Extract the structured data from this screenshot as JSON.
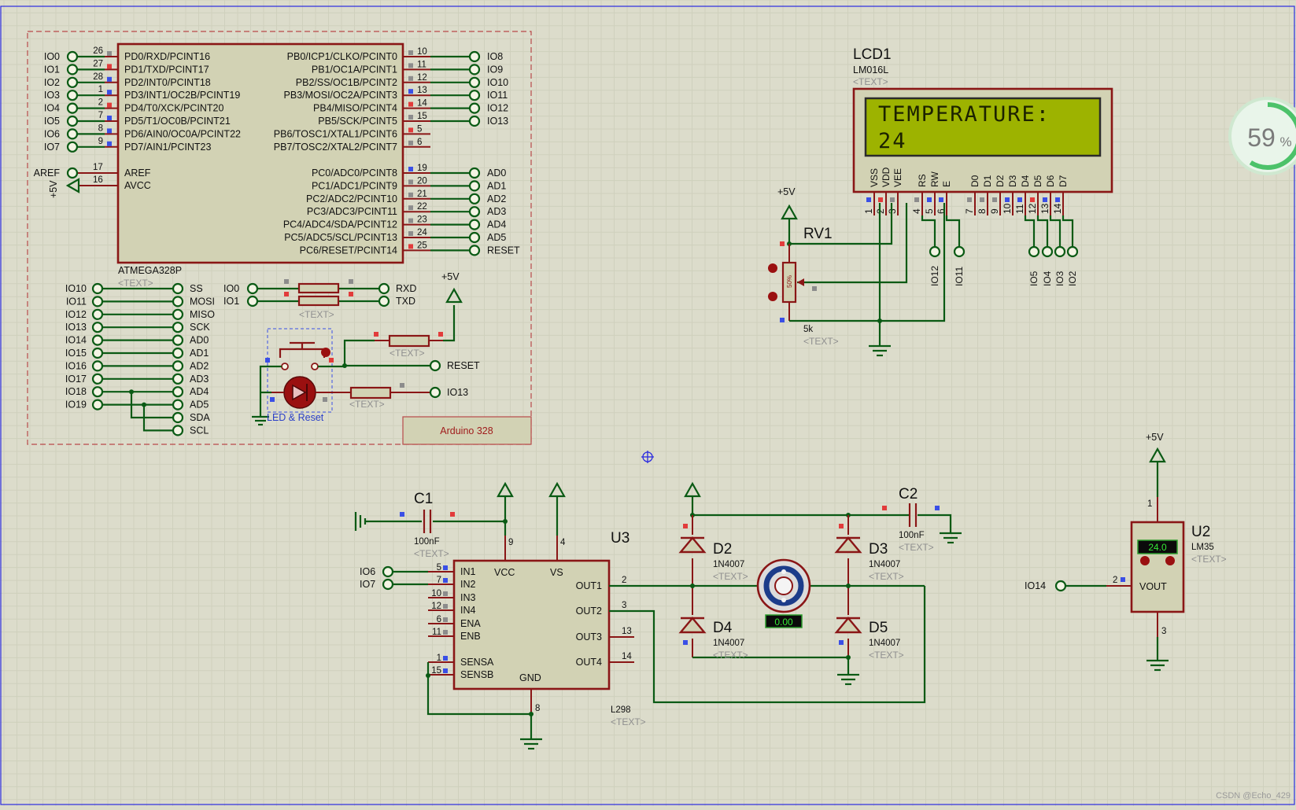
{
  "badge": {
    "value": "59",
    "unit": "%"
  },
  "watermark": "CSDN @Echo_429",
  "arduino": {
    "frame_label": "Arduino 328",
    "chip": "ATMEGA328P",
    "text": "<TEXT>",
    "left_pins": [
      {
        "num": "26",
        "name": "PD0/RXD/PCINT16",
        "net": "IO0"
      },
      {
        "num": "27",
        "name": "PD1/TXD/PCINT17",
        "net": "IO1"
      },
      {
        "num": "28",
        "name": "PD2/INT0/PCINT18",
        "net": "IO2"
      },
      {
        "num": "1",
        "name": "PD3/INT1/OC2B/PCINT19",
        "net": "IO3"
      },
      {
        "num": "2",
        "name": "PD4/T0/XCK/PCINT20",
        "net": "IO4"
      },
      {
        "num": "7",
        "name": "PD5/T1/OC0B/PCINT21",
        "net": "IO5"
      },
      {
        "num": "8",
        "name": "PD6/AIN0/OC0A/PCINT22",
        "net": "IO6"
      },
      {
        "num": "9",
        "name": "PD7/AIN1/PCINT23",
        "net": "IO7"
      }
    ],
    "aref": {
      "num": "17",
      "name": "AREF",
      "net": "AREF"
    },
    "avcc": {
      "num": "16",
      "name": "AVCC",
      "net": "+5V"
    },
    "right_pins_b": [
      {
        "num": "10",
        "name": "PB0/ICP1/CLKO/PCINT0",
        "net": "IO8"
      },
      {
        "num": "11",
        "name": "PB1/OC1A/PCINT1",
        "net": "IO9"
      },
      {
        "num": "12",
        "name": "PB2/SS/OC1B/PCINT2",
        "net": "IO10"
      },
      {
        "num": "13",
        "name": "PB3/MOSI/OC2A/PCINT3",
        "net": "IO11"
      },
      {
        "num": "14",
        "name": "PB4/MISO/PCINT4",
        "net": "IO12"
      },
      {
        "num": "15",
        "name": "PB5/SCK/PCINT5",
        "net": "IO13"
      },
      {
        "num": "5",
        "name": "PB6/TOSC1/XTAL1/PCINT6",
        "net": ""
      },
      {
        "num": "6",
        "name": "PB7/TOSC2/XTAL2/PCINT7",
        "net": ""
      }
    ],
    "right_pins_c": [
      {
        "num": "19",
        "name": "PC0/ADC0/PCINT8",
        "net": "AD0"
      },
      {
        "num": "20",
        "name": "PC1/ADC1/PCINT9",
        "net": "AD1"
      },
      {
        "num": "21",
        "name": "PC2/ADC2/PCINT10",
        "net": "AD2"
      },
      {
        "num": "22",
        "name": "PC3/ADC3/PCINT11",
        "net": "AD3"
      },
      {
        "num": "23",
        "name": "PC4/ADC4/SDA/PCINT12",
        "net": "AD4"
      },
      {
        "num": "24",
        "name": "PC5/ADC5/SCL/PCINT13",
        "net": "AD5"
      },
      {
        "num": "25",
        "name": "PC6/RESET/PCINT14",
        "net": "RESET"
      }
    ],
    "header": [
      {
        "left": "IO10",
        "right": "SS"
      },
      {
        "left": "IO11",
        "right": "MOSI"
      },
      {
        "left": "IO12",
        "right": "MISO"
      },
      {
        "left": "IO13",
        "right": "SCK"
      },
      {
        "left": "IO14",
        "right": "AD0"
      },
      {
        "left": "IO15",
        "right": "AD1"
      },
      {
        "left": "IO16",
        "right": "AD2"
      },
      {
        "left": "IO17",
        "right": "AD3"
      },
      {
        "left": "IO18",
        "right": "AD4"
      },
      {
        "left": "IO19",
        "right": "AD5"
      },
      {
        "left": "",
        "right": "SDA"
      },
      {
        "left": "",
        "right": "SCL"
      }
    ],
    "uart": {
      "a": "IO0",
      "b": "IO1",
      "rx": "RXD",
      "tx": "TXD"
    },
    "vcc": "+5V",
    "reset_label": "RESET",
    "io13_label": "IO13",
    "led_reset_label": "LED & Reset"
  },
  "lcd": {
    "ref": "LCD1",
    "model": "LM016L",
    "text": "<TEXT>",
    "line1": "TEMPERATURE:",
    "line2": "24",
    "pins": [
      {
        "num": "1",
        "name": "VSS"
      },
      {
        "num": "2",
        "name": "VDD"
      },
      {
        "num": "3",
        "name": "VEE"
      },
      {
        "num": "4",
        "name": "RS"
      },
      {
        "num": "5",
        "name": "RW"
      },
      {
        "num": "6",
        "name": "E"
      },
      {
        "num": "7",
        "name": "D0"
      },
      {
        "num": "8",
        "name": "D1"
      },
      {
        "num": "9",
        "name": "D2"
      },
      {
        "num": "10",
        "name": "D3"
      },
      {
        "num": "11",
        "name": "D4"
      },
      {
        "num": "12",
        "name": "D5"
      },
      {
        "num": "13",
        "name": "D6"
      },
      {
        "num": "14",
        "name": "D7"
      }
    ],
    "nets": {
      "rs": "IO12",
      "e": "IO11",
      "d4": "IO5",
      "d5": "IO4",
      "d6": "IO3",
      "d7": "IO2"
    }
  },
  "rv1": {
    "ref": "RV1",
    "value": "5k",
    "text": "<TEXT>",
    "vcc": "+5V",
    "pct": "50%"
  },
  "c1": {
    "ref": "C1",
    "value": "100nF",
    "text": "<TEXT>"
  },
  "c2": {
    "ref": "C2",
    "value": "100nF",
    "text": "<TEXT>"
  },
  "u3": {
    "ref": "U3",
    "model": "L298",
    "text": "<TEXT>",
    "left": [
      {
        "num": "5",
        "name": "IN1",
        "net": "IO6"
      },
      {
        "num": "7",
        "name": "IN2",
        "net": "IO7"
      },
      {
        "num": "10",
        "name": "IN3",
        "net": ""
      },
      {
        "num": "12",
        "name": "IN4",
        "net": ""
      },
      {
        "num": "6",
        "name": "ENA",
        "net": ""
      },
      {
        "num": "11",
        "name": "ENB",
        "net": ""
      },
      {
        "num": "1",
        "name": "SENSA",
        "net": ""
      },
      {
        "num": "15",
        "name": "SENSB",
        "net": ""
      }
    ],
    "right": [
      {
        "num": "2",
        "name": "OUT1"
      },
      {
        "num": "3",
        "name": "OUT2"
      },
      {
        "num": "13",
        "name": "OUT3"
      },
      {
        "num": "14",
        "name": "OUT4"
      }
    ],
    "vcc": {
      "num": "9",
      "name": "VCC"
    },
    "vs": {
      "num": "4",
      "name": "VS"
    },
    "gnd": {
      "num": "8",
      "name": "GND"
    }
  },
  "diodes": [
    {
      "ref": "D2",
      "model": "1N4007",
      "text": "<TEXT>"
    },
    {
      "ref": "D3",
      "model": "1N4007",
      "text": "<TEXT>"
    },
    {
      "ref": "D4",
      "model": "1N4007",
      "text": "<TEXT>"
    },
    {
      "ref": "D5",
      "model": "1N4007",
      "text": "<TEXT>"
    }
  ],
  "motor": {
    "reading": "0.00"
  },
  "u2": {
    "ref": "U2",
    "model": "LM35",
    "text": "<TEXT>",
    "reading": "24.0",
    "pin1": "1",
    "pin2": "2",
    "pin3": "3",
    "out": "VOUT",
    "net": "IO14",
    "vcc": "+5V"
  },
  "text_placeholder": "<TEXT>",
  "colors": {
    "background": "#dcdccb",
    "wire": "#0a5a14",
    "component": "#8a1616",
    "lcd_screen": "#9db300"
  }
}
